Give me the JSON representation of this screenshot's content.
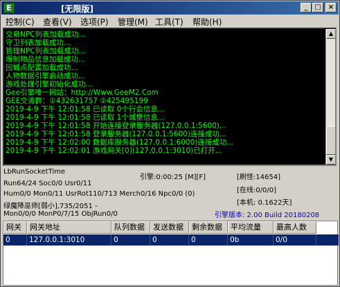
{
  "window": {
    "app_icon_letter": "E",
    "title": "[无限版]",
    "buttons": {
      "minimize": "_",
      "maximize": "□",
      "close": "×"
    }
  },
  "menu": [
    "控制(C)",
    "查看(V)",
    "选项(P)",
    "管理(M)",
    "工具(T)",
    "帮助(H)"
  ],
  "log": {
    "lines": [
      "交易NPC列表加载成功...",
      "守卫列表加载成功...",
      "管理NPC列表加载成功...",
      "爆制物品信息加载成功...",
      "回城点配置加载成功...",
      "人物数据引擎启动成功...",
      "游戏处理引擎初始化成功...",
      "Gee引擎唯一网站：http://Www.GeeM2.Com",
      "GEE交流群：①432631757   ②425495199",
      "2019-4-9 下午 12:01:58 已读取 0个行会信息...",
      "2019-4-9 下午 12:01:58 已读取 1个城堡信息...",
      "2019-4-9 下午 12:01:58 开始连接登录服务器(127.0.0.1:5600)...",
      "2019-4-9 下午 12:01:58 登录服务器(127.0.0.1:5600)连接成功...",
      "2019-4-9 下午 12:02:00 数据库服务器(127.0.0.1:6000)连接成功...",
      "2019-4-9 下午 12:02:01 游戏网关[0](127.0.0.1:3010)已打开..."
    ],
    "color": "#00ff00"
  },
  "status": {
    "run_socket": "LbRunSocketTime",
    "run_counts": "Run64/24 Soc0/0 Usr0/11",
    "hum_counts": "Hum0/0 Mon0/11 UsrRot110/713 Merch0/16 Npc0/0 (0)",
    "player": "绿魔降巫师[弱小],735/2051 -",
    "mon_counts": "Mon0/0/0 MonP0/7/15 ObjRun0/0",
    "engine_time": "引擎:0:00:25 [M][F]",
    "refresh": "[刷怪:14654]",
    "online": "[在线:0/0/0]",
    "local": "[本机: 0.1622天]",
    "engine_version": "引擎版本: 2.00 Build 20180208",
    "version_color": "#0000c8"
  },
  "table": {
    "headers": [
      "网关",
      "网关地址",
      "队列数据",
      "发送数据",
      "剩余数据",
      "平均流量",
      "最高人数"
    ],
    "rows": [
      [
        "0",
        "127.0.0.1:3010",
        "0",
        "0",
        "0",
        "0b",
        "0/0"
      ]
    ],
    "selected_bg": "#0a246a"
  }
}
